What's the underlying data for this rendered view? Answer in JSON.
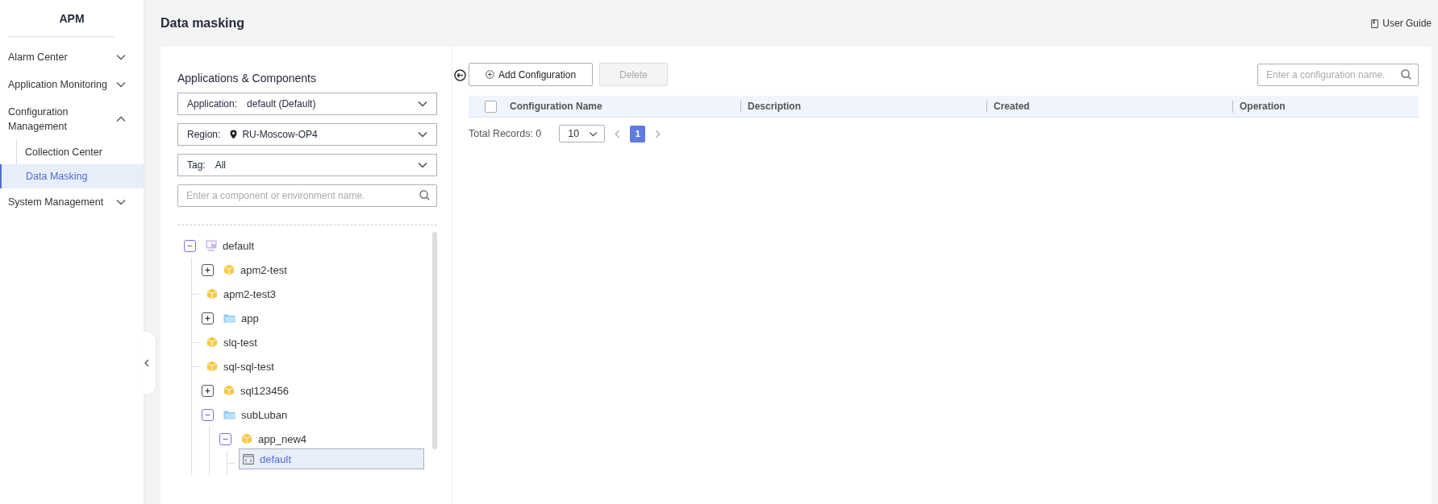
{
  "sidebar": {
    "title": "APM",
    "items": [
      {
        "label": "Alarm Center",
        "expanded": false
      },
      {
        "label": "Application Monitoring",
        "expanded": false
      },
      {
        "label": "Configuration Management",
        "expanded": true,
        "children": [
          {
            "label": "Collection Center",
            "selected": false
          },
          {
            "label": "Data Masking",
            "selected": true
          }
        ]
      },
      {
        "label": "System Management",
        "expanded": false
      }
    ]
  },
  "page": {
    "title": "Data masking",
    "guide_link": "User Guide"
  },
  "filters": {
    "title": "Applications & Components",
    "selects": [
      {
        "kind": "plain",
        "label": "Application:",
        "value": "default (Default)"
      },
      {
        "kind": "location",
        "label": "Region:",
        "value": "RU-Moscow-OP4"
      },
      {
        "kind": "plain",
        "label": "Tag:",
        "value": "All"
      }
    ],
    "search": {
      "placeholder": "Enter a component or environment name."
    }
  },
  "tree": [
    {
      "label": "default",
      "kind": "application",
      "expanded": true,
      "selected": false,
      "children": [
        {
          "label": "apm2-test",
          "kind": "component",
          "expanded": false,
          "selected": false
        },
        {
          "label": "apm2-test3",
          "kind": "component",
          "selected": false
        },
        {
          "label": "app",
          "kind": "folder",
          "expanded": false,
          "selected": false
        },
        {
          "label": "slq-test",
          "kind": "component",
          "selected": false
        },
        {
          "label": "sql-sql-test",
          "kind": "component",
          "selected": false
        },
        {
          "label": "sql123456",
          "kind": "component",
          "expanded": false,
          "selected": false
        },
        {
          "label": "subLuban",
          "kind": "folder",
          "expanded": true,
          "selected": false,
          "children": [
            {
              "label": "app_new4",
              "kind": "component",
              "expanded": true,
              "selected": false,
              "children": [
                {
                  "label": "default",
                  "kind": "environment",
                  "selected": true
                }
              ]
            }
          ]
        }
      ]
    }
  ],
  "toolbar": {
    "add_button": "Add Configuration",
    "delete_button": {
      "label": "Delete",
      "disabled": true
    },
    "search": {
      "placeholder": "Enter a configuration name."
    }
  },
  "table": {
    "select_all_checked": false,
    "columns": [
      "Configuration Name",
      "Description",
      "Created",
      "Operation"
    ]
  },
  "pagination": {
    "total": "Total Records: 0",
    "page_size": "10",
    "pages": [
      {
        "label": "1",
        "selected": true
      }
    ]
  }
}
